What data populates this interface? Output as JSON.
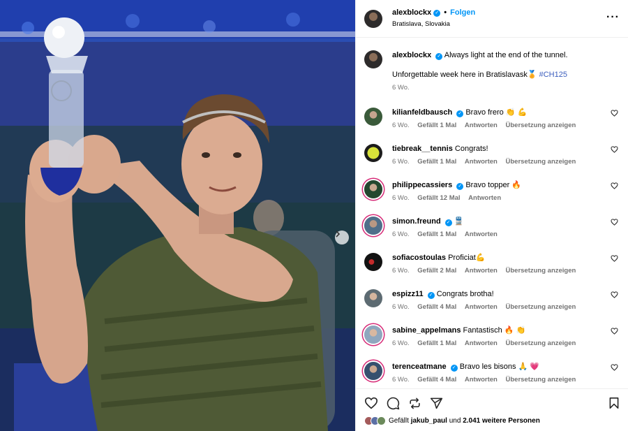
{
  "post": {
    "username": "alexblockx",
    "follow_label": "Folgen",
    "separator": "•",
    "location": "Bratislava, Slovakia"
  },
  "caption": {
    "username": "alexblockx",
    "line1": "Always light at the end of the tunnel.",
    "line2_text": "Unforgettable week here in Bratislavask🏅",
    "hashtag": "#CH125",
    "time": "6 Wo."
  },
  "comments": [
    {
      "username": "kilianfeldbausch",
      "verified": true,
      "text": "Bravo frero 👏 💪",
      "time": "6 Wo.",
      "likes": "Gefällt 1 Mal",
      "reply": "Antworten",
      "translate": "Übersetzung anzeigen"
    },
    {
      "username": "tiebreak__tennis",
      "verified": false,
      "text": "Congrats!",
      "time": "6 Wo.",
      "likes": "Gefällt 1 Mal",
      "reply": "Antworten",
      "translate": "Übersetzung anzeigen"
    },
    {
      "username": "philippecassiers",
      "verified": true,
      "text": "Bravo topper 🔥",
      "time": "6 Wo.",
      "likes": "Gefällt 12 Mal",
      "reply": "Antworten",
      "translate": ""
    },
    {
      "username": "simon.freund",
      "verified": true,
      "text": "🚆",
      "time": "6 Wo.",
      "likes": "Gefällt 1 Mal",
      "reply": "Antworten",
      "translate": ""
    },
    {
      "username": "sofiacostoulas",
      "verified": false,
      "text": "Proficiat💪",
      "time": "6 Wo.",
      "likes": "Gefällt 2 Mal",
      "reply": "Antworten",
      "translate": "Übersetzung anzeigen"
    },
    {
      "username": "espizz11",
      "verified": true,
      "text": "Congrats brotha!",
      "time": "6 Wo.",
      "likes": "Gefällt 4 Mal",
      "reply": "Antworten",
      "translate": "Übersetzung anzeigen"
    },
    {
      "username": "sabine_appelmans",
      "verified": false,
      "text": "Fantastisch 🔥 👏",
      "time": "6 Wo.",
      "likes": "Gefällt 1 Mal",
      "reply": "Antworten",
      "translate": "Übersetzung anzeigen"
    },
    {
      "username": "terenceatmane",
      "verified": true,
      "text": "Bravo les bisons 🙏 💗",
      "time": "6 Wo.",
      "likes": "Gefällt 4 Mal",
      "reply": "Antworten",
      "translate": "Übersetzung anzeigen"
    }
  ],
  "footer": {
    "likes_prefix": "Gefällt",
    "likes_user": "jakub_paul",
    "likes_mid": "und",
    "likes_count": "2.041 weitere Personen"
  },
  "icons": {
    "more": "more-options-icon",
    "heart": "heart-icon",
    "comment": "comment-icon",
    "repost": "repost-icon",
    "share": "share-icon",
    "save": "bookmark-icon",
    "next": "chevron-right-icon",
    "verified": "verified-badge-icon"
  },
  "colors": {
    "accent": "#0095f6",
    "muted": "#737373",
    "border": "#efefef"
  }
}
